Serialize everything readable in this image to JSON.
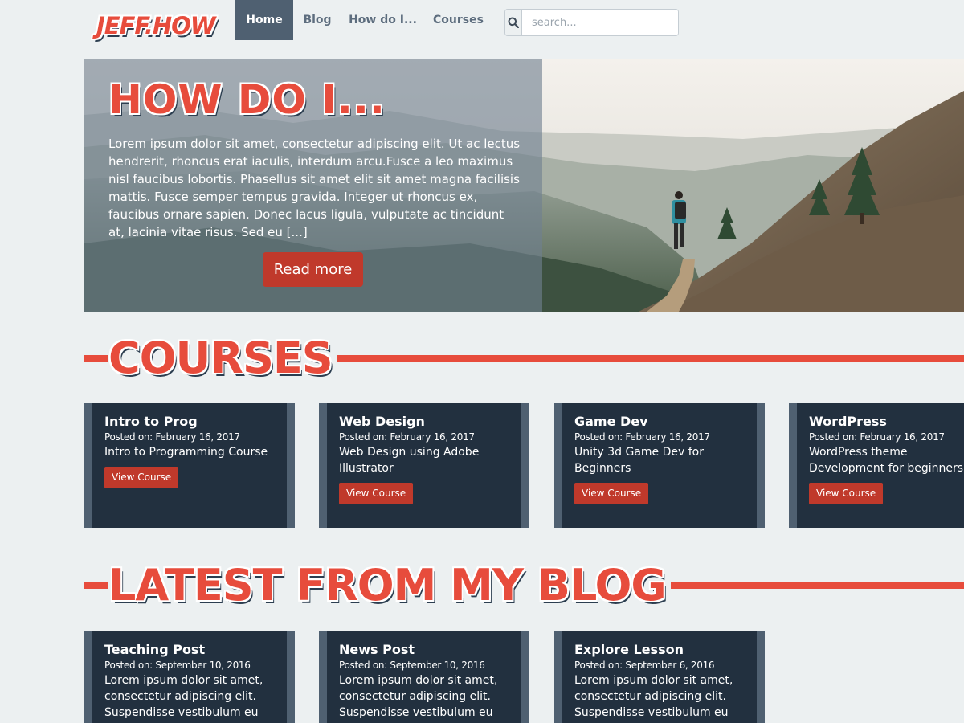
{
  "brand": {
    "logo_text": "JEFF.HOW"
  },
  "nav": {
    "items": [
      {
        "label": "Home",
        "active": true
      },
      {
        "label": "Blog"
      },
      {
        "label": "How do I..."
      },
      {
        "label": "Courses"
      }
    ],
    "search": {
      "placeholder": "search...",
      "icon": "search-icon"
    }
  },
  "hero": {
    "title": "HOW DO I...",
    "excerpt": "Lorem ipsum dolor sit amet, consectetur adipiscing elit. Ut ac lectus hendrerit, rhoncus erat iaculis, interdum arcu.Fusce a leo maximus nisl faucibus lobortis. Phasellus sit amet elit sit amet magna facilisis mattis. Fusce semper tempus gravida. Integer ut rhoncus ex, faucibus ornare sapien. Donec lacus ligula, vulputate ac tincidunt at, lacinia vitae risus. Sed eu [...]",
    "button_label": "Read more"
  },
  "courses": {
    "heading": "COURSES",
    "items": [
      {
        "title": "Intro to Prog",
        "date": "Posted on: February 16, 2017",
        "description": "Intro to Programming Course",
        "button_label": "View Course"
      },
      {
        "title": "Web Design",
        "date": "Posted on: February 16, 2017",
        "description": "Web Design using Adobe Illustrator",
        "button_label": "View Course"
      },
      {
        "title": "Game Dev",
        "date": "Posted on: February 16, 2017",
        "description": "Unity 3d Game Dev for Beginners",
        "button_label": "View Course"
      },
      {
        "title": "WordPress",
        "date": "Posted on: February 16, 2017",
        "description": "WordPress theme Development for beginners",
        "button_label": "View Course"
      }
    ]
  },
  "blog": {
    "heading": "LATEST FROM MY BLOG",
    "items": [
      {
        "title": "Teaching Post",
        "date": "Posted on: September 10, 2016",
        "excerpt": "Lorem ipsum dolor sit amet, consectetur adipiscing elit. Suspendisse vestibulum eu"
      },
      {
        "title": "News Post",
        "date": "Posted on: September 10, 2016",
        "excerpt": "Lorem ipsum dolor sit amet, consectetur adipiscing elit. Suspendisse vestibulum eu"
      },
      {
        "title": "Explore Lesson",
        "date": "Posted on: September 6, 2016",
        "excerpt": "Lorem ipsum dolor sit amet, consectetur adipiscing elit. Suspendisse vestibulum eu"
      }
    ]
  },
  "colors": {
    "accent": "#e74c3c",
    "button": "#c0392b",
    "card_bg": "#22303f",
    "card_border": "#4f6071",
    "page_bg": "#ecf0f1"
  }
}
